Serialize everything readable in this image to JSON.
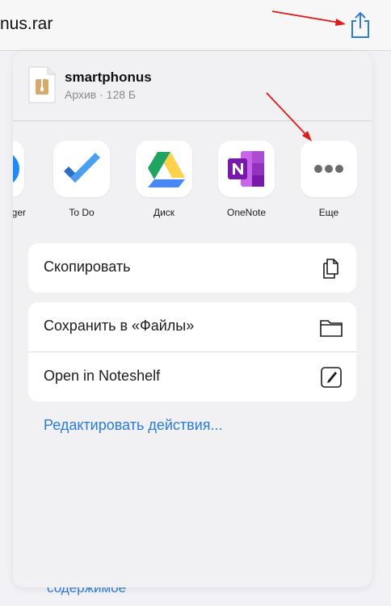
{
  "header": {
    "title_fragment": "nus.rar"
  },
  "sheet": {
    "file": {
      "name": "smartphonus",
      "meta": "Архив · 128 Б",
      "icon": "archive-file-icon"
    },
    "apps": [
      {
        "label": "ger",
        "icon": "messenger-icon"
      },
      {
        "label": "To Do",
        "icon": "todo-icon"
      },
      {
        "label": "Диск",
        "icon": "google-drive-icon"
      },
      {
        "label": "OneNote",
        "icon": "onenote-icon"
      },
      {
        "label": "Еще",
        "icon": "more-icon"
      }
    ],
    "actions_group1": [
      {
        "label": "Скопировать",
        "icon": "copy-icon"
      }
    ],
    "actions_group2": [
      {
        "label": "Сохранить в «Файлы»",
        "icon": "folder-icon"
      },
      {
        "label": "Open in Noteshelf",
        "icon": "noteshelf-icon"
      }
    ],
    "edit_actions_label": "Редактировать действия..."
  },
  "background": {
    "bottom_link": "содержимое"
  },
  "colors": {
    "accent": "#2b7cd9",
    "annotation_arrow": "#e0191b"
  }
}
